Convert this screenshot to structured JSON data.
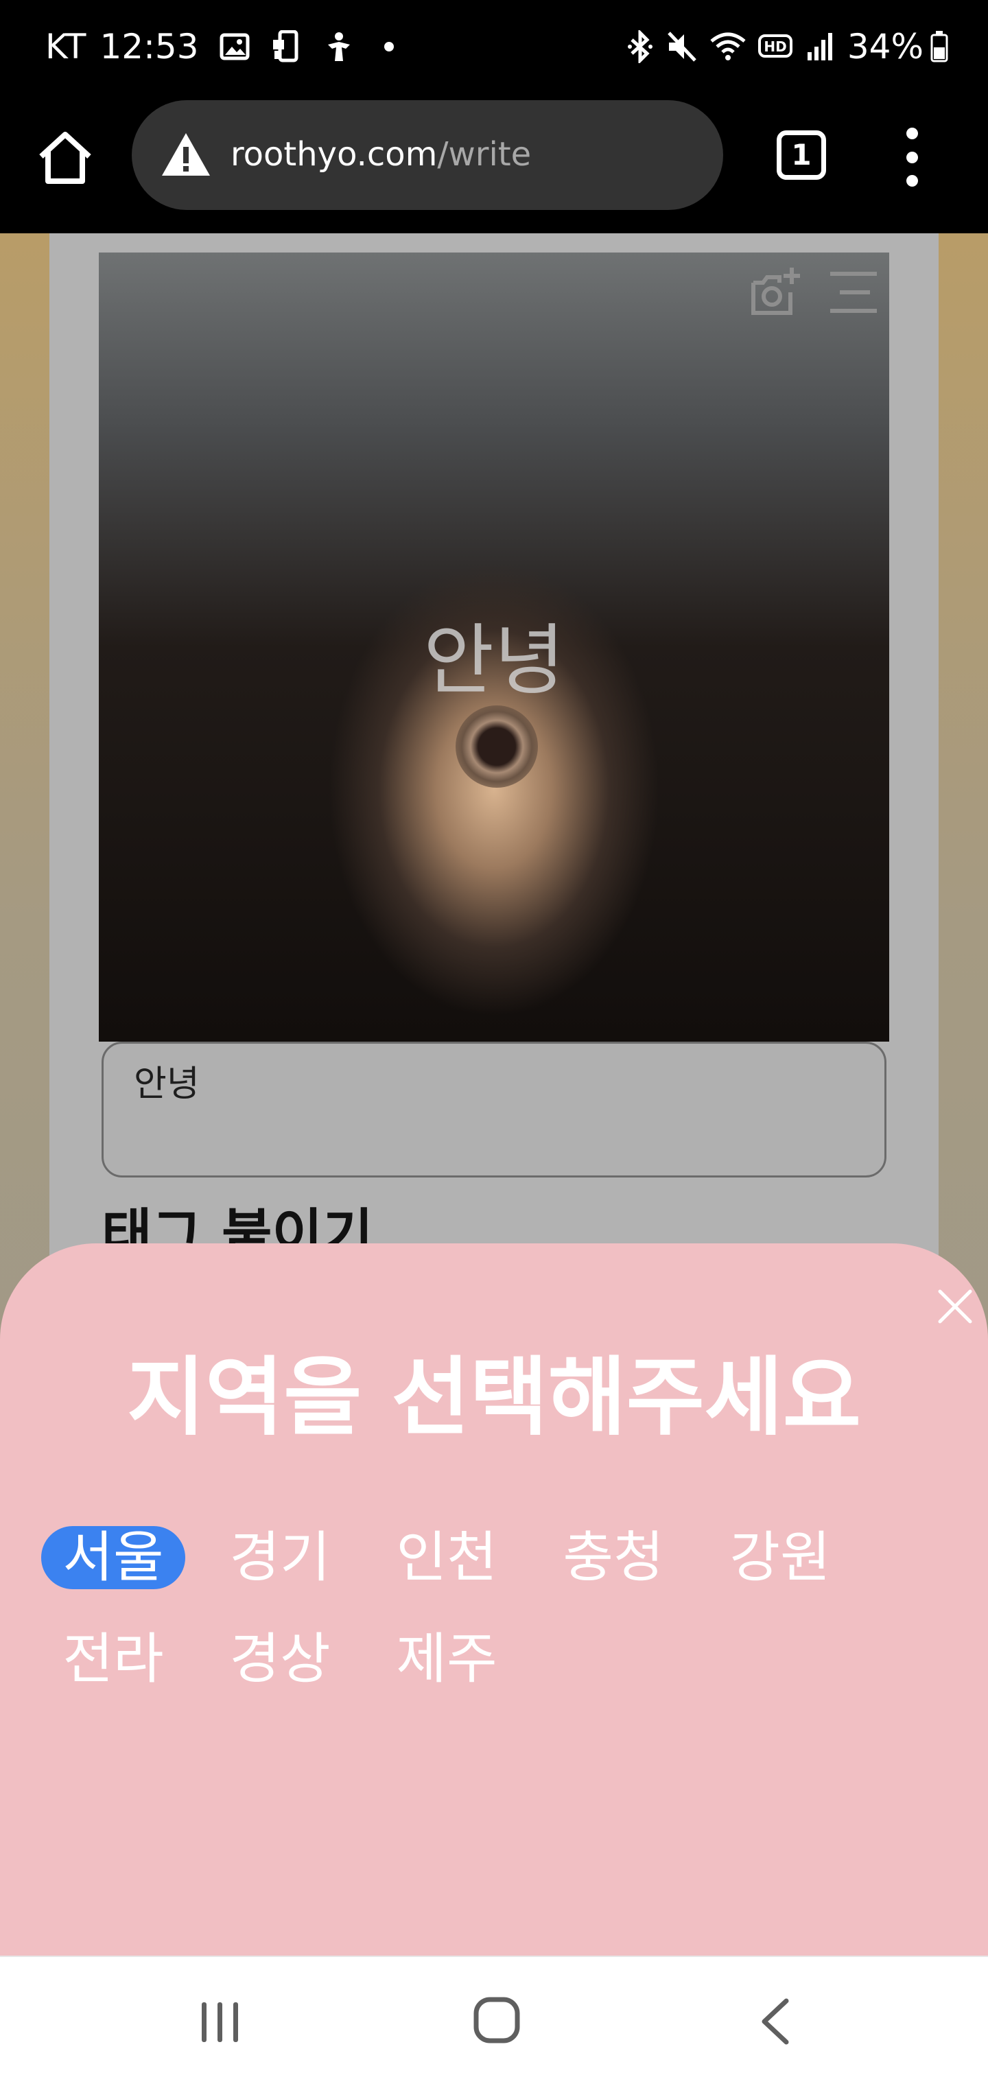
{
  "status_bar": {
    "carrier": "KT",
    "time": "12:53",
    "battery": "34%",
    "left_icons": [
      "gallery-icon",
      "phone-sync-icon",
      "accessibility-icon",
      "notification-dot"
    ],
    "right_icons": [
      "bluetooth-icon",
      "mute-icon",
      "wifi-icon",
      "hd-icon",
      "signal-icon",
      "battery-icon"
    ]
  },
  "browser": {
    "url_domain": "roothyo.com",
    "url_path": "/write",
    "tab_count": "1"
  },
  "page": {
    "photo_caption": "안녕",
    "text_value": "안녕",
    "section_heading": "태그 붙이기"
  },
  "sheet": {
    "title": "지역을 선택해주세요",
    "regions": [
      "서울",
      "경기",
      "인천",
      "충청",
      "강원",
      "전라",
      "경상",
      "제주"
    ],
    "selected_region": "서울"
  },
  "colors": {
    "sheet_bg": "#f1bfc3",
    "selected_chip": "#3b82f0",
    "url_bar": "#333333"
  }
}
